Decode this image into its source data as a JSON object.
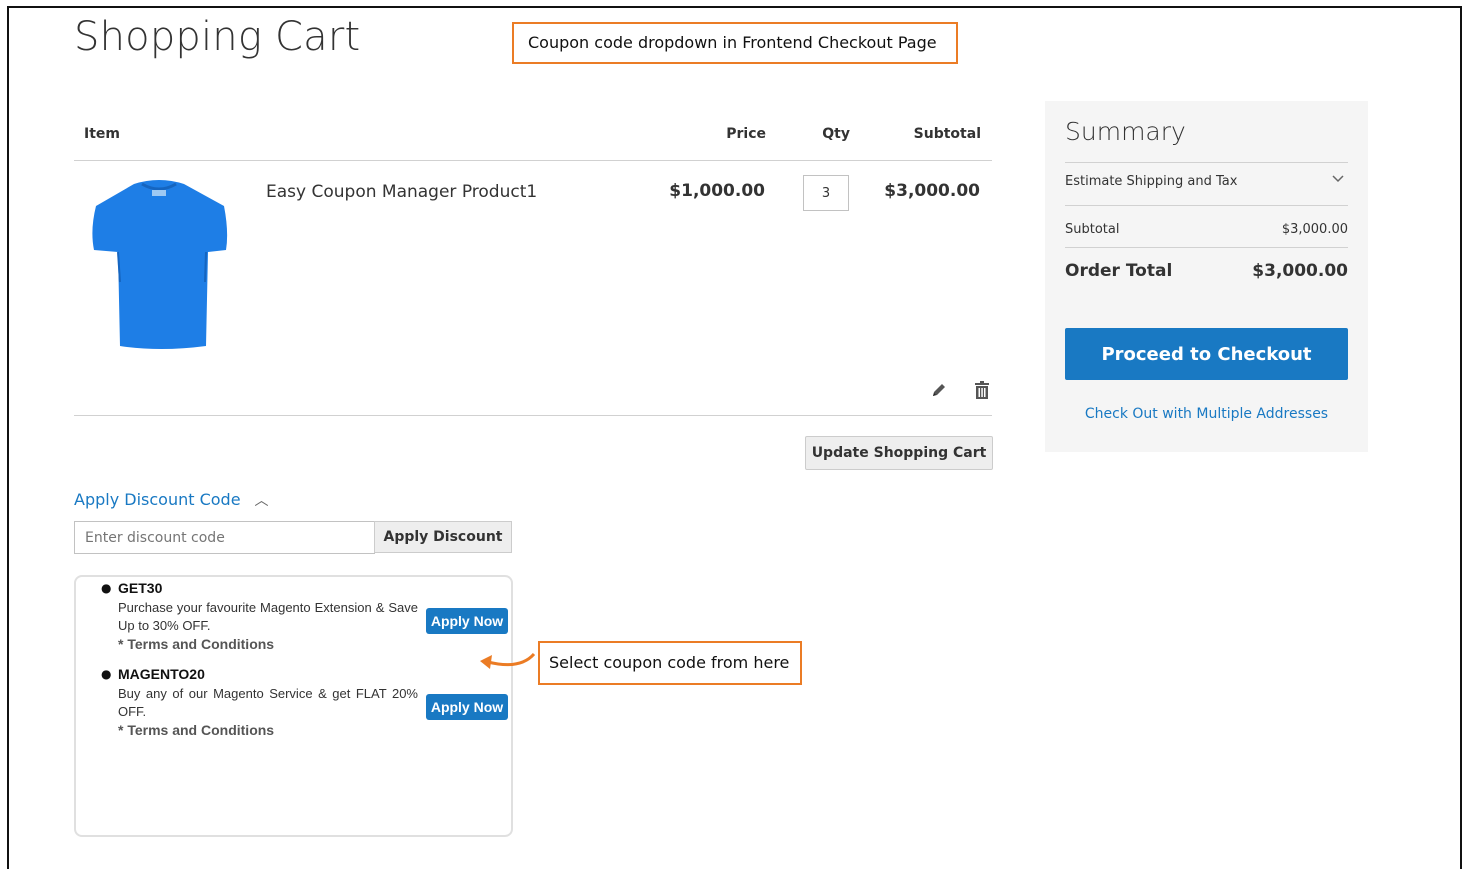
{
  "page": {
    "title": "Shopping Cart"
  },
  "callouts": {
    "top": "Coupon code dropdown in Frontend Checkout Page",
    "side": "Select coupon code from here"
  },
  "cart": {
    "headers": {
      "item": "Item",
      "price": "Price",
      "qty": "Qty",
      "subtotal": "Subtotal"
    },
    "item": {
      "name": "Easy Coupon Manager Product1",
      "price": "$1,000.00",
      "qty": "3",
      "subtotal": "$3,000.00",
      "image_icon": "blue-tshirt-icon"
    },
    "update_label": "Update Shopping Cart"
  },
  "discount": {
    "toggle_label": "Apply Discount Code",
    "input_placeholder": "Enter discount code",
    "apply_label": "Apply Discount",
    "coupons": [
      {
        "code": "GET30",
        "description": "Purchase your favourite Magento Extension & Save Up to 30% OFF.",
        "terms": "* Terms and Conditions",
        "button": "Apply Now"
      },
      {
        "code": "MAGENTO20",
        "description": "Buy any of our Magento Service & get FLAT 20% OFF.",
        "terms": "* Terms and Conditions",
        "button": "Apply Now"
      }
    ]
  },
  "summary": {
    "title": "Summary",
    "shipping_label": "Estimate Shipping and Tax",
    "subtotal_label": "Subtotal",
    "subtotal_value": "$3,000.00",
    "total_label": "Order Total",
    "total_value": "$3,000.00",
    "checkout_label": "Proceed to Checkout",
    "multi_label": "Check Out with Multiple Addresses"
  },
  "colors": {
    "accent": "#1979c3",
    "callout": "#eb7c25",
    "summary_bg": "#f5f5f5",
    "tshirt": "#1e7ee6"
  }
}
